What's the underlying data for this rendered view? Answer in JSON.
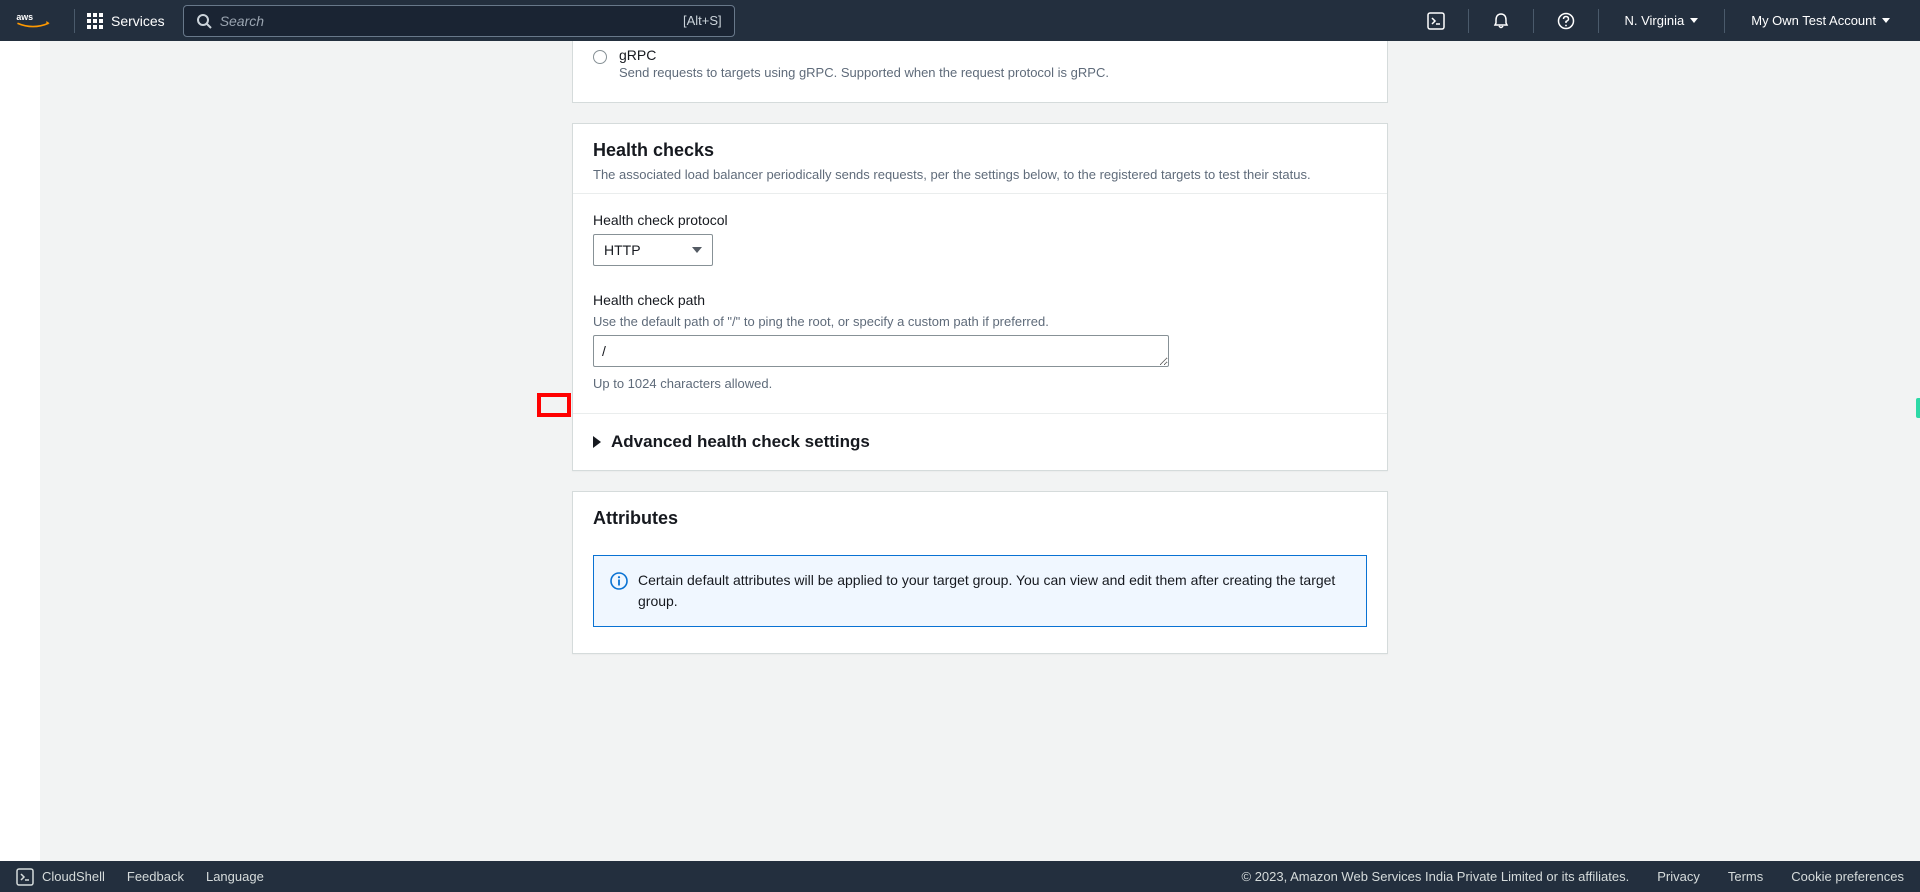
{
  "topnav": {
    "services_label": "Services",
    "search_placeholder": "Search",
    "search_shortcut": "[Alt+S]",
    "region": "N. Virginia",
    "account": "My Own Test Account"
  },
  "protocol_card": {
    "grpc": {
      "label": "gRPC",
      "desc": "Send requests to targets using gRPC. Supported when the request protocol is gRPC."
    }
  },
  "health": {
    "title": "Health checks",
    "desc": "The associated load balancer periodically sends requests, per the settings below, to the registered targets to test their status.",
    "protocol_label": "Health check protocol",
    "protocol_value": "HTTP",
    "path_label": "Health check path",
    "path_help": "Use the default path of \"/\" to ping the root, or specify a custom path if preferred.",
    "path_value": "/",
    "path_hint": "Up to 1024 characters allowed.",
    "advanced_label": "Advanced health check settings"
  },
  "attributes": {
    "title": "Attributes",
    "info": "Certain default attributes will be applied to your target group. You can view and edit them after creating the target group."
  },
  "footer": {
    "cloudshell": "CloudShell",
    "feedback": "Feedback",
    "language": "Language",
    "copyright": "© 2023, Amazon Web Services India Private Limited or its affiliates.",
    "privacy": "Privacy",
    "terms": "Terms",
    "cookies": "Cookie preferences"
  }
}
